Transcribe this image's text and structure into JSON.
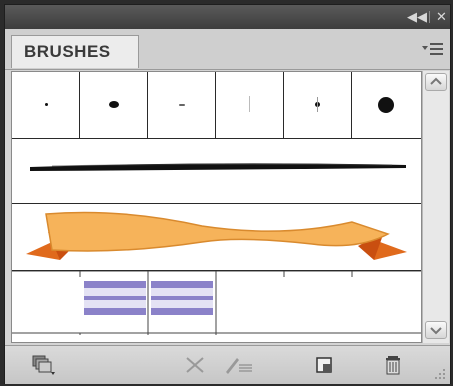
{
  "panel": {
    "tab_label": "BRUSHES"
  },
  "titlebar": {
    "collapse_icon": "double-chevron-left-icon",
    "close_icon": "close-icon"
  },
  "menu": {
    "icon": "panel-menu-icon"
  },
  "brushes": {
    "calligraphic": [
      "tiny-dot-brush",
      "small-oval-brush",
      "dash-brush",
      "thin-vertical-brush",
      "small-star-brush",
      "large-round-brush"
    ],
    "art": [
      "charcoal-stroke-brush"
    ],
    "decorative": [
      "ribbon-banner-brush"
    ],
    "pattern": [
      "stripe-pattern-brush"
    ]
  },
  "colors": {
    "ribbon_light": "#f6b35a",
    "ribbon_dark": "#e06a1c",
    "pattern_purple": "#8b82c9",
    "pattern_light": "#c9c6e8"
  },
  "toolbar": {
    "icons": [
      "brush-libraries-menu-icon",
      "remove-brush-stroke-icon",
      "options-of-selected-object-icon",
      "new-brush-icon",
      "delete-brush-icon"
    ]
  }
}
